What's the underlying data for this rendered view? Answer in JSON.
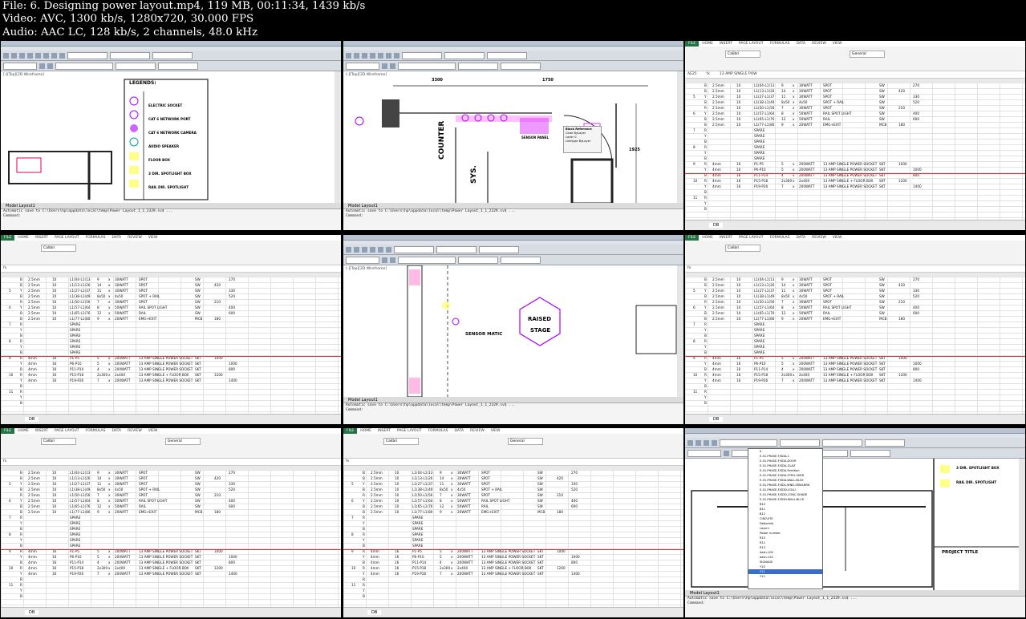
{
  "header": {
    "line1": "File: 6. Designing power layout.mp4, 119 MB, 00:11:34, 1439 kb/s",
    "line2": "Video: AVC, 1300 kb/s, 1280x720, 30.000 FPS",
    "line3": "Audio: AAC LC, 128 kb/s, 2 channels, 48.0 kHz"
  },
  "cad": {
    "workspace": "AutoCAD Classic",
    "layer_dd": "Standard",
    "bylayer": "ByLayer",
    "viewport": "[-][Top][2D Wireframe]",
    "tab_model": "Model",
    "tab_layout": "Layout1",
    "cmd_autosave": "Automatic save to C:\\Users\\hp\\appdata\\local\\temp\\Power Layout_1_1_2329.sv$ ...",
    "cmd_prompt": "Command:"
  },
  "legend": {
    "title": "LEGENDS:",
    "items": [
      "ELECTRIC SOCKET",
      "CAT 6 NETWORK PORT",
      "CAT 6 NETWORK CAMERA",
      "AUDIO SPEAKER",
      "FLOOR BOX",
      "3 DIR. SPOTLIGHT BOX",
      "RAIL DIR. SPOTLIGHT"
    ]
  },
  "plan": {
    "dim1": "3300",
    "dim2": "1750",
    "dim3": "1925",
    "counter": "COUNTER",
    "sys": "SYS.",
    "sensor_panel": "SENSOR PANEL",
    "popup_title": "Block Reference",
    "popup_rows": [
      "Color",
      "Layer",
      "Linetype"
    ],
    "popup_vals": [
      "ByLayer",
      "0",
      "ByLayer"
    ]
  },
  "stage": {
    "sensor": "SENSOR MATIC",
    "raised1": "RAISED",
    "raised2": "STAGE"
  },
  "layout3": {
    "legend_items": [
      "3 DIR. SPOTLIGHT BOX",
      "RAIL DIR. SPOTLIGHT"
    ],
    "project_title": "PROJECT TITLE",
    "layers": [
      "0",
      "E-01-PHASE-F/SDA-1",
      "E-01-PHASE-F/SDA-DOOR",
      "E-01-PHASE-F/SDA-GLAZ",
      "E-01-PHASE-F/SDA-Partition",
      "E-01-PHASE-F/SDA-STRU-SHER",
      "E-01-PHASE-F/SDA-WALL-BLCK",
      "E-01-PHASE-F/SDL-WND-SPAN-BRK",
      "E-01-PHASE-F/SDD-COLU",
      "E-01-PHASE-F/SDD-CONC-SHADE",
      "E-01-PHASE-F/SDD-WALL-BLCK",
      "B10",
      "B11",
      "B12",
      "CIRCUITS",
      "Defpoints",
      "Layer1",
      "Power number",
      "R10",
      "R11",
      "R12",
      "dash-100",
      "dash-120",
      "SIGNAGE",
      "Y10",
      "Y11",
      "Y12"
    ]
  },
  "excel": {
    "tabs": [
      "FILE",
      "HOME",
      "INSERT",
      "PAGE LAYOUT",
      "FORMULAS",
      "DATA",
      "REVIEW",
      "VIEW"
    ],
    "font": "Calibri",
    "number_format": "General",
    "sheet_tab": "DB",
    "cells": [
      "AE25",
      "fx",
      "13 AMP SINGLE POW"
    ],
    "rows": [
      [
        "",
        "B",
        "2.5mm",
        "10",
        "L1(04-L1(13",
        "9",
        "x",
        "30WATT",
        "SPOT",
        "SW",
        "",
        "270"
      ],
      [
        "",
        "B",
        "2.5mm",
        "10",
        "L1(13-L1(26",
        "14",
        "x",
        "30WATT",
        "SPOT",
        "SW",
        "420",
        ""
      ],
      [
        "5",
        "Y",
        "2.5mm",
        "10",
        "L1(27-L1(37",
        "11",
        "x",
        "30WATT",
        "SPOT",
        "SW",
        "",
        "330"
      ],
      [
        "",
        "B",
        "2.5mm",
        "10",
        "L1(38-L1(49",
        "8x50",
        "x",
        "4x50",
        "SPOT + RAIL",
        "SW",
        "",
        "520"
      ],
      [
        "",
        "R",
        "2.5mm",
        "10",
        "L1(50-L1(56",
        "7",
        "x",
        "30WATT",
        "SPOT",
        "SW",
        "210",
        ""
      ],
      [
        "6",
        "Y",
        "2.5mm",
        "10",
        "L1(57-L1(64",
        "8",
        "x",
        "50WATT",
        "RAIL SPOT LIGHT",
        "SW",
        "",
        "400"
      ],
      [
        "",
        "B",
        "2.5mm",
        "10",
        "L1(65-L1(76",
        "12",
        "x",
        "50WATT",
        "RAIL",
        "SW",
        "",
        "600"
      ],
      [
        "",
        "B",
        "2.5mm",
        "10",
        "L1(77-L1(80",
        "9",
        "x",
        "20WATT",
        "EMG+EXIT",
        "MCB",
        "180",
        ""
      ],
      [
        "7",
        "R",
        "",
        "",
        "SPARE",
        "",
        "",
        "",
        "",
        "",
        "",
        ""
      ],
      [
        "",
        "Y",
        "",
        "",
        "SPARE",
        "",
        "",
        "",
        "",
        "",
        "",
        ""
      ],
      [
        "",
        "B",
        "",
        "",
        "SPARE",
        "",
        "",
        "",
        "",
        "",
        "",
        ""
      ],
      [
        "8",
        "R",
        "",
        "",
        "SPARE",
        "",
        "",
        "",
        "",
        "",
        "",
        ""
      ],
      [
        "",
        "Y",
        "",
        "",
        "SPARE",
        "",
        "",
        "",
        "",
        "",
        "",
        ""
      ],
      [
        "",
        "B",
        "",
        "",
        "SPARE",
        "",
        "",
        "",
        "",
        "",
        "",
        ""
      ],
      [
        "9",
        "R",
        "4mm",
        "16",
        "P1-P5",
        "5",
        "x",
        "200WATT",
        "13 AMP SINGLE POWER SOCKET",
        "SKT",
        "1000",
        ""
      ],
      [
        "",
        "Y",
        "4mm",
        "16",
        "P6-P10",
        "5",
        "x",
        "200WATT",
        "13 AMP SINGLE POWER SOCKET",
        "SKT",
        "",
        "1000"
      ],
      [
        "",
        "B",
        "4mm",
        "16",
        "P11-P14",
        "4",
        "x",
        "200WATT",
        "13 AMP SINGLE POWER SOCKET",
        "SKT",
        "",
        "800"
      ],
      [
        "10",
        "R",
        "4mm",
        "16",
        "P15-P18",
        "2x300",
        "x",
        "2x400",
        "13 AMP SINGLE + FLOOR BOX",
        "SKT",
        "1200",
        ""
      ],
      [
        "",
        "Y",
        "4mm",
        "16",
        "P19-P26",
        "7",
        "x",
        "200WATT",
        "13 AMP SINGLE POWER SOCKET",
        "SKT",
        "",
        "1400"
      ],
      [
        "",
        "B",
        "",
        "",
        "",
        "",
        "",
        "",
        "",
        "",
        "",
        ""
      ],
      [
        "11",
        "R",
        "",
        "",
        "",
        "",
        "",
        "",
        "",
        "",
        "",
        ""
      ],
      [
        "",
        "Y",
        "",
        "",
        "",
        "",
        "",
        "",
        "",
        "",
        "",
        ""
      ],
      [
        "",
        "B",
        "",
        "",
        "",
        "",
        "",
        "",
        "",
        "",
        "",
        ""
      ]
    ]
  }
}
